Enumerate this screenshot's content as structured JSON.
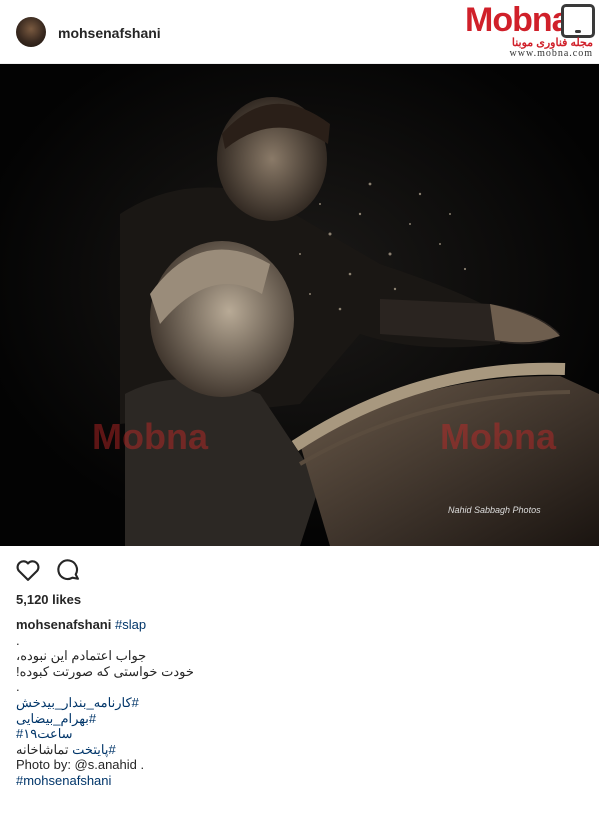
{
  "post": {
    "username": "mohsenafshani",
    "avatar_icon": "profile-photo"
  },
  "watermark_logo": {
    "word": "Mobna",
    "subtitle": "مجله فناوری موبنا",
    "url": "www.mobna.com",
    "brand_color": "#d0202a"
  },
  "photo": {
    "watermark_left": "Mobna",
    "watermark_right": "Mobna",
    "credit": "Nahid Sabbagh Photos"
  },
  "actions": {
    "like_icon": "heart-icon",
    "comment_icon": "comment-icon"
  },
  "likes": "5,120 likes",
  "caption": {
    "user": "mohsenafshani",
    "first_tag": "#slap",
    "dot1": ".",
    "line1": "جواب اعتمادم این نبوده،",
    "line2": "خودت خواستی که صورتت کبوده!",
    "dot2": ".",
    "tag1": "#کارنامه_بندار_بیدخش",
    "tag2": "#بهرام_بیضایی",
    "tag3": "ساعت۱۹#",
    "line_theatre": "تماشاخانه",
    "tag4": "#پایتخت",
    "photo_by": "Photo by: @s.anahid .",
    "tag5": "#mohsenafshani"
  }
}
